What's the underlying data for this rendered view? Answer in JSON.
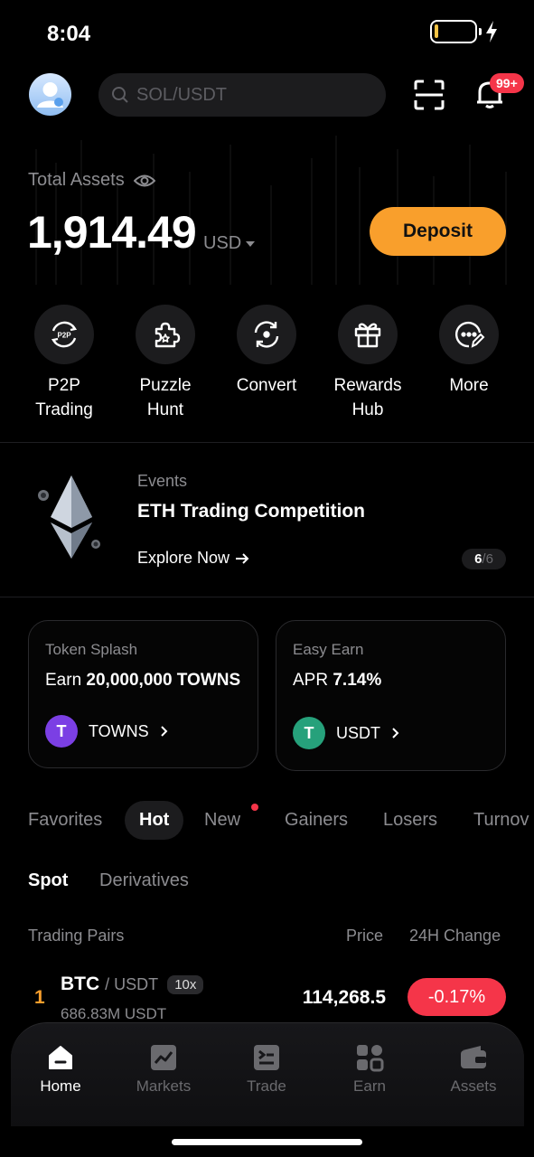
{
  "status": {
    "time": "8:04"
  },
  "search": {
    "placeholder": "SOL/USDT"
  },
  "notifications": {
    "badge": "99+"
  },
  "assets": {
    "label": "Total Assets",
    "value": "1,914.49",
    "currency": "USD",
    "deposit_label": "Deposit"
  },
  "quick_actions": [
    {
      "label": "P2P\nTrading",
      "icon": "p2p-icon",
      "icon_text": "P2P"
    },
    {
      "label": "Puzzle\nHunt",
      "icon": "puzzle-icon"
    },
    {
      "label": "Convert",
      "icon": "convert-icon"
    },
    {
      "label": "Rewards\nHub",
      "icon": "gift-icon"
    },
    {
      "label": "More",
      "icon": "more-icon"
    }
  ],
  "event": {
    "tag": "Events",
    "title": "ETH Trading Competition",
    "link": "Explore Now",
    "page_current": "6",
    "page_total": "/6"
  },
  "cards": [
    {
      "tag": "Token Splash",
      "prefix": "Earn",
      "highlight": "20,000,000 TOWNS",
      "token": "TOWNS",
      "token_color": "#7b3fe4",
      "token_icon_text": "T"
    },
    {
      "tag": "Easy Earn",
      "prefix": "APR",
      "highlight": "7.14%",
      "token": "USDT",
      "token_color": "#26a17b",
      "token_icon_text": "T"
    }
  ],
  "market_tabs": [
    "Favorites",
    "Hot",
    "New",
    "Gainers",
    "Losers",
    "Turnov"
  ],
  "sub_tabs": [
    "Spot",
    "Derivatives"
  ],
  "columns": {
    "pair": "Trading Pairs",
    "price": "Price",
    "change": "24H Change"
  },
  "rows": [
    {
      "rank": "1",
      "base": "BTC",
      "quote": "/ USDT",
      "leverage": "10x",
      "volume": "686.83M USDT",
      "price": "114,268.5",
      "change": "-0.17%",
      "change_color": "#f53549"
    }
  ],
  "nav": [
    {
      "label": "Home",
      "icon": "home-icon"
    },
    {
      "label": "Markets",
      "icon": "chart-icon"
    },
    {
      "label": "Trade",
      "icon": "trade-icon"
    },
    {
      "label": "Earn",
      "icon": "earn-icon"
    },
    {
      "label": "Assets",
      "icon": "wallet-icon"
    }
  ]
}
